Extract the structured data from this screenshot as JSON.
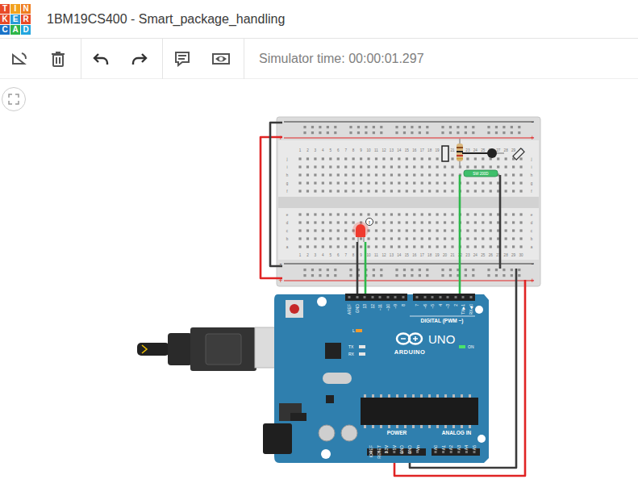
{
  "app": {
    "logo": [
      {
        "letter": "T",
        "color": "#e84a27"
      },
      {
        "letter": "I",
        "color": "#f2a21e"
      },
      {
        "letter": "N",
        "color": "#ef7d20"
      },
      {
        "letter": "K",
        "color": "#e84a27"
      },
      {
        "letter": "E",
        "color": "#2a9ad8"
      },
      {
        "letter": "R",
        "color": "#e84a27"
      },
      {
        "letter": "C",
        "color": "#1a73c8"
      },
      {
        "letter": "A",
        "color": "#2fb54a"
      },
      {
        "letter": "D",
        "color": "#22a5de"
      }
    ],
    "title": "1BM19CS400 - Smart_package_handling"
  },
  "simulator": {
    "label": "Simulator time: 00:00:01.297"
  },
  "breadboard": {
    "columns": [
      "1",
      "2",
      "3",
      "4",
      "5",
      "6",
      "7",
      "8",
      "9",
      "10",
      "11",
      "12",
      "13",
      "14",
      "15",
      "16",
      "17",
      "18",
      "19",
      "20",
      "21",
      "22",
      "23",
      "24",
      "25",
      "26",
      "27",
      "28",
      "29",
      "30"
    ],
    "rows_top": [
      "j",
      "i",
      "h",
      "g",
      "f"
    ],
    "rows_bottom": [
      "e",
      "d",
      "c",
      "b",
      "a"
    ],
    "rail_plus": "+",
    "rail_minus": "-"
  },
  "components": {
    "sensor_label": "SW 200D",
    "led": {
      "on": true,
      "color": "#f03a2e",
      "warning": "!"
    }
  },
  "wires": [
    {
      "color": "#e02424"
    },
    {
      "color": "#3a3a3a"
    },
    {
      "color": "#3a3a3a"
    },
    {
      "color": "#2db84b"
    },
    {
      "color": "#2db84b"
    },
    {
      "color": "#3a3a3a"
    },
    {
      "color": "#e02424"
    },
    {
      "color": "#3a3a3a"
    }
  ],
  "arduino": {
    "brand": "ARDUINO",
    "model": "UNO",
    "digital_title": "DIGITAL (PWM ~)",
    "digital_pins": [
      "AREF",
      "GND",
      "13",
      "12",
      "~11",
      "~10",
      "~9",
      "8",
      "7",
      "~6",
      "~5",
      "4",
      "~3",
      "2",
      "TX▶1",
      "RX◀0"
    ],
    "power_title": "POWER",
    "power_pins": [
      "IOREF",
      "RESET",
      "3.3V",
      "5V",
      "GND",
      "GND",
      "Vin"
    ],
    "analog_title": "ANALOG IN",
    "analog_pins": [
      "A0",
      "A1",
      "A2",
      "A3",
      "A4",
      "A5"
    ],
    "leds": [
      {
        "label": "L",
        "on": true
      },
      {
        "label": "TX",
        "on": false
      },
      {
        "label": "RX",
        "on": false
      },
      {
        "label": "ON",
        "on": true
      }
    ]
  }
}
